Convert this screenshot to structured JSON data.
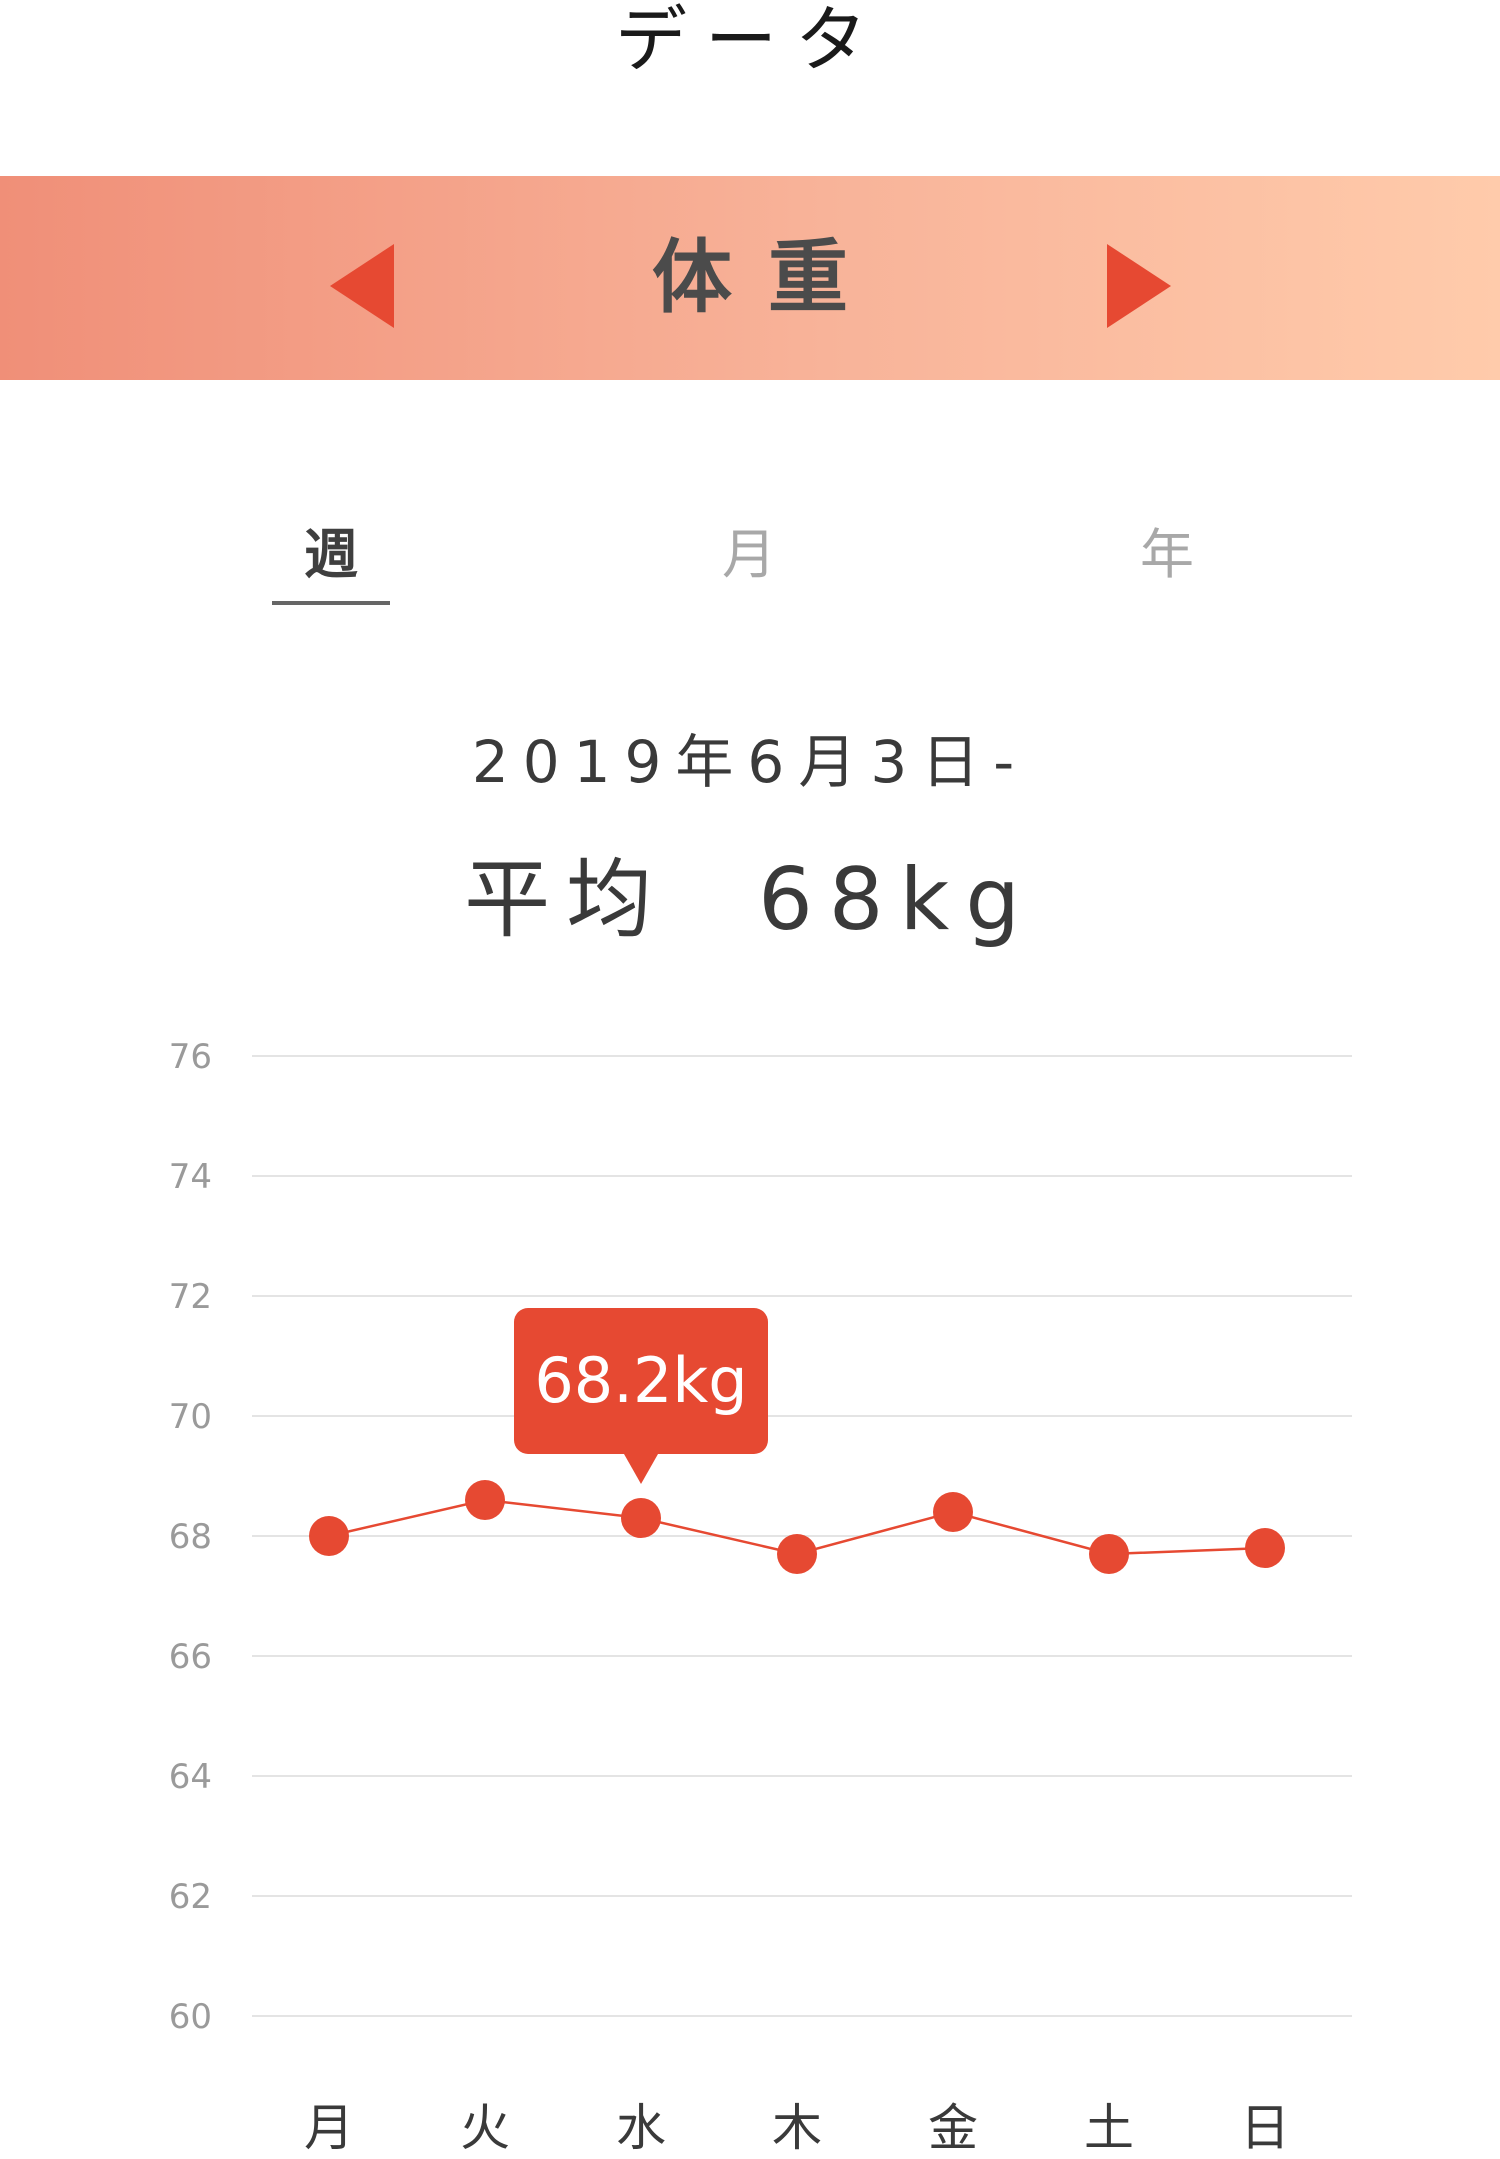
{
  "header": {
    "title": "データ"
  },
  "banner": {
    "title": "体重",
    "prev_icon": "triangle-left-icon",
    "next_icon": "triangle-right-icon",
    "background_start": "#f08f78",
    "background_end": "#ffcbab",
    "arrow_color": "#e64932"
  },
  "tabs": [
    {
      "label": "週",
      "active": true
    },
    {
      "label": "月",
      "active": false
    },
    {
      "label": "年",
      "active": false
    }
  ],
  "summary": {
    "date_range": "2019年6月3日-",
    "average_label": "平均",
    "average_value": "68kg"
  },
  "tooltip": {
    "text": "68.2kg"
  },
  "chart_data": {
    "type": "line",
    "categories": [
      "月",
      "火",
      "水",
      "木",
      "金",
      "土",
      "日"
    ],
    "values": [
      68.0,
      68.6,
      68.3,
      67.7,
      68.4,
      67.7,
      67.8
    ],
    "ylim": [
      60,
      76
    ],
    "yticks": [
      60,
      62,
      64,
      66,
      68,
      70,
      72,
      74,
      76
    ],
    "grid": true,
    "color": "#e64932",
    "highlighted_index": 2
  }
}
